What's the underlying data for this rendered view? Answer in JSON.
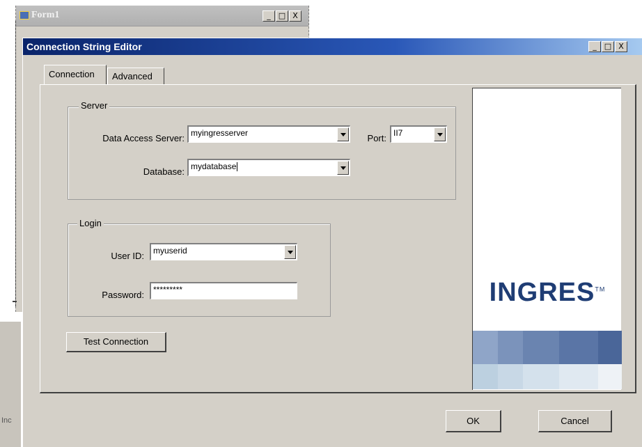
{
  "background_window": {
    "title": "Form1",
    "caption_buttons": [
      "_",
      "□",
      "X"
    ],
    "side_text": "Inc"
  },
  "dialog": {
    "title": "Connection String Editor",
    "caption_buttons": [
      "_",
      "□",
      "X"
    ],
    "tabs": [
      {
        "label": "Connection",
        "selected": true
      },
      {
        "label": "Advanced",
        "selected": false
      }
    ],
    "server": {
      "group_label": "Server",
      "data_access_server_label": "Data Access Server:",
      "data_access_server_value": "myingresserver",
      "port_label": "Port:",
      "port_value": "II7",
      "database_label": "Database:",
      "database_value": "mydatabase"
    },
    "login": {
      "group_label": "Login",
      "user_id_label": "User ID:",
      "user_id_value": "myuserid",
      "password_label": "Password:",
      "password_value": "*********"
    },
    "test_connection_label": "Test Connection",
    "ok_label": "OK",
    "cancel_label": "Cancel"
  },
  "brand": {
    "logo_text": "INGRES",
    "trademark": "TM",
    "colors": {
      "logo": "#1f3d74",
      "tiles_row1": [
        "#8fa5c8",
        "#7b93bb",
        "#6a84b0",
        "#5a75a6",
        "#4a6699"
      ],
      "tiles_row2": [
        "#bcd0e0",
        "#c8d8e6",
        "#d4e1ec",
        "#e0e9f1",
        "#eef2f6"
      ]
    }
  },
  "colors": {
    "titlebar_start": "#0a246a",
    "titlebar_end": "#a6caf0",
    "face": "#d4d0c8"
  }
}
